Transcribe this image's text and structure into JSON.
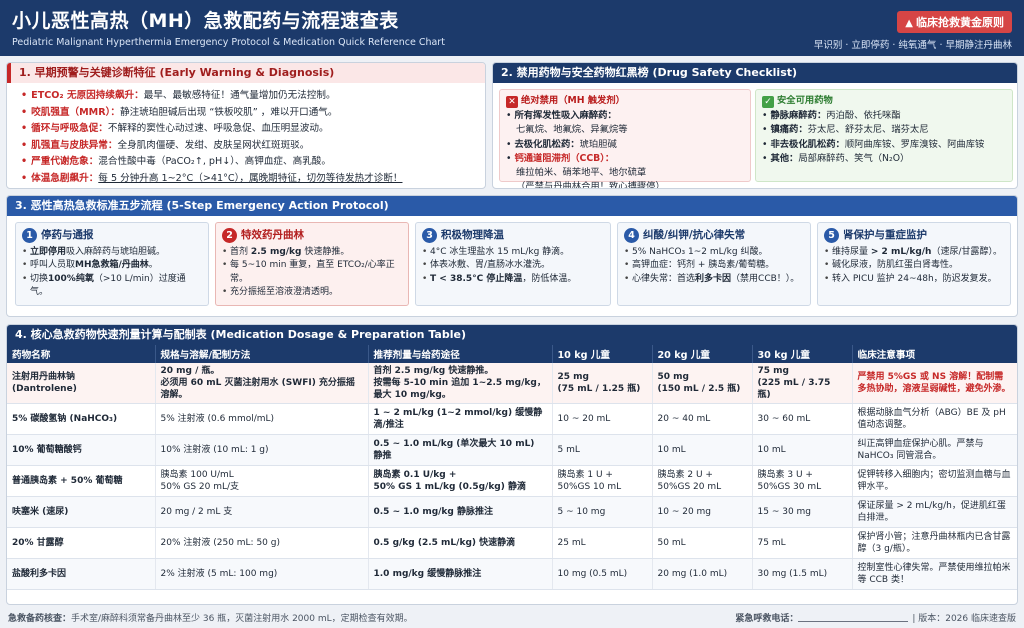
{
  "header": {
    "title": "小儿恶性高热（MH）急救配药与流程速查表",
    "subtitle": "Pediatric Malignant Hyperthermia Emergency Protocol & Medication Quick Reference Chart",
    "badge": "临床抢救黄金原则",
    "tagline": "早识别 · 立即停药 · 纯氧通气 · 早期静注丹曲林"
  },
  "section1": {
    "title": "1. 早期预警与关键诊断特征 (Early Warning & Diagnosis)",
    "items": [
      {
        "key": "ETCO₂ 无原因持续飙升：",
        "text": "最早、最敏感特征！通气量增加仍无法控制。"
      },
      {
        "key": "咬肌强直（MMR）：",
        "text": "静注琥珀胆碱后出现 “铁板咬肌” ，难以开口通气。"
      },
      {
        "key": "循环与呼吸急促：",
        "text": "不解释的窦性心动过速、呼吸急促、血压明显波动。"
      },
      {
        "key": "肌强直与皮肤异常：",
        "text": "全身肌肉僵硬、发绀、皮肤呈网状红斑斑驳。"
      },
      {
        "key": "严重代谢危象：",
        "text": "混合性酸中毒（PaCO₂↑, pH↓）、高钾血症、高乳酸。"
      },
      {
        "key": "体温急剧飙升：",
        "text": "每 5 分钟升高 1~2°C（>41°C），属晚期特征，切勿等待发热才诊断！"
      }
    ]
  },
  "section2": {
    "title": "2. 禁用药物与安全药物红黑榜 (Drug Safety Checklist)",
    "banned_title": "绝对禁用（MH 触发剂）",
    "banned": [
      {
        "head": "所有挥发性吸入麻醉药：",
        "detail": "七氟烷、地氟烷、异氟烷等"
      },
      {
        "head": "去极化肌松药：",
        "detail": "琥珀胆碱"
      },
      {
        "head": "钙通道阻滞剂（CCB）：",
        "detail": "维拉帕米、硝苯地平、地尔硫䓬",
        "note": "（严禁与丹曲林合用！致心搏骤停）"
      }
    ],
    "safe_title": "安全可用药物",
    "safe": [
      {
        "head": "静脉麻醉药：",
        "detail": "丙泊酚、依托咪酯"
      },
      {
        "head": "镇痛药：",
        "detail": "芬太尼、舒芬太尼、瑞芬太尼"
      },
      {
        "head": "非去极化肌松药：",
        "detail": "顺阿曲库铵、罗库溴铵、阿曲库铵"
      },
      {
        "head": "其他：",
        "detail": "局部麻醉药、笑气（N₂O）"
      }
    ]
  },
  "section3": {
    "title": "3. 恶性高热急救标准五步流程 (5-Step Emergency Action Protocol)",
    "steps": [
      {
        "num": "1",
        "title": "停药与通报",
        "items": [
          "立即停用吸入麻醉药与琥珀胆碱。",
          "呼叫人员取MH急救箱/丹曲林。",
          "切换100%纯氧（>10 L/min）过度通气。"
        ]
      },
      {
        "num": "2",
        "title": "特效药丹曲林",
        "items": [
          "首剂 2.5 mg/kg 快速静推。",
          "每 5~10 min 重复，直至 ETCO₂/心率正常。",
          "充分振摇至溶液澄清透明。"
        ]
      },
      {
        "num": "3",
        "title": "积极物理降温",
        "items": [
          "4°C 冰生理盐水 15 mL/kg 静滴。",
          "体表冰敷、胃/直肠冰水灌洗。",
          "T < 38.5°C 停止降温，防低体温。"
        ]
      },
      {
        "num": "4",
        "title": "纠酸/纠钾/抗心律失常",
        "items": [
          "5% NaHCO₃ 1~2 mL/kg 纠酸。",
          "高钾血症：钙剂 + 胰岛素/葡萄糖。",
          "心律失常：首选利多卡因（禁用CCB！）。"
        ]
      },
      {
        "num": "5",
        "title": "肾保护与重症监护",
        "items": [
          "维持尿量 > 2 mL/kg/h（速尿/甘露醇）。",
          "碱化尿液，防肌红蛋白肾毒性。",
          "转入 PICU 监护 24~48h，防迟发复发。"
        ]
      }
    ]
  },
  "section4": {
    "title": "4. 核心急救药物快速剂量计算与配制表 (Medication Dosage & Preparation Table)",
    "headers": [
      "药物名称",
      "规格与溶解/配制方法",
      "推荐剂量与给药途径",
      "10 kg 儿童",
      "20 kg 儿童",
      "30 kg 儿童",
      "临床注意事项"
    ],
    "rows": [
      [
        "注射用丹曲林钠\n(Dantrolene)",
        "20 mg / 瓶。\n必须用 60 mL 灭菌注射用水 (SWFI) 充分振摇溶解。",
        "首剂 2.5 mg/kg 快速静推。\n按需每 5-10 min 追加 1~2.5 mg/kg，最大 10 mg/kg。",
        "25 mg\n(75 mL / 1.25 瓶)",
        "50 mg\n(150 mL / 2.5 瓶)",
        "75 mg\n(225 mL / 3.75 瓶)",
        "严禁用 5%GS 或 NS 溶解！配制需多热协助，溶液呈弱碱性，避免外渗。"
      ],
      [
        "5% 碳酸氢钠 (NaHCO₃)",
        "5% 注射液 (0.6 mmol/mL)",
        "1 ~ 2 mL/kg (1~2 mmol/kg) 缓慢静滴/推注",
        "10 ~ 20 mL",
        "20 ~ 40 mL",
        "30 ~ 60 mL",
        "根据动脉血气分析（ABG）BE 及 pH 值动态调整。"
      ],
      [
        "10% 葡萄糖酸钙",
        "10% 注射液 (10 mL: 1 g)",
        "0.5 ~ 1.0 mL/kg (单次最大 10 mL) 静推",
        "5 mL",
        "10 mL",
        "10 mL",
        "纠正高钾血症保护心肌。严禁与 NaHCO₃ 同管混合。"
      ],
      [
        "普通胰岛素 + 50% 葡萄糖",
        "胰岛素 100 U/mL\n50% GS 20 mL/支",
        "胰岛素 0.1 U/kg +\n50% GS 1 mL/kg (0.5g/kg) 静滴",
        "胰岛素 1 U +\n50%GS 10 mL",
        "胰岛素 2 U +\n50%GS 20 mL",
        "胰岛素 3 U +\n50%GS 30 mL",
        "促钾转移入细胞内；密切监测血糖与血钾水平。"
      ],
      [
        "呋塞米 (速尿)",
        "20 mg / 2 mL 支",
        "0.5 ~ 1.0 mg/kg 静脉推注",
        "5 ~ 10 mg",
        "10 ~ 20 mg",
        "15 ~ 30 mg",
        "保证尿量 > 2 mL/kg/h，促进肌红蛋白排泄。"
      ],
      [
        "20% 甘露醇",
        "20% 注射液 (250 mL: 50 g)",
        "0.5 g/kg (2.5 mL/kg) 快速静滴",
        "25 mL",
        "50 mL",
        "75 mL",
        "保护肾小管；注意丹曲林瓶内已含甘露醇（3 g/瓶）。"
      ],
      [
        "盐酸利多卡因",
        "2% 注射液 (5 mL: 100 mg)",
        "1.0 mg/kg 缓慢静脉推注",
        "10 mg (0.5 mL)",
        "20 mg (1.0 mL)",
        "30 mg (1.5 mL)",
        "控制室性心律失常。严禁使用维拉帕米等 CCB 类！"
      ]
    ]
  },
  "footer": {
    "left_label": "急救备药核查：",
    "left_text": "手术室/麻醉科须常备丹曲林至少 36 瓶，灭菌注射用水 2000 mL，定期检查有效期。",
    "phone_label": "紧急呼救电话：",
    "version": "版本：2026 临床速查版"
  },
  "colors": {
    "navy": "#1c3a6b",
    "alert_red": "#c62828",
    "safe_green": "#2e7d32"
  },
  "icons": {
    "badge": "warning-icon",
    "banned": "cross-icon",
    "safe": "check-icon"
  }
}
